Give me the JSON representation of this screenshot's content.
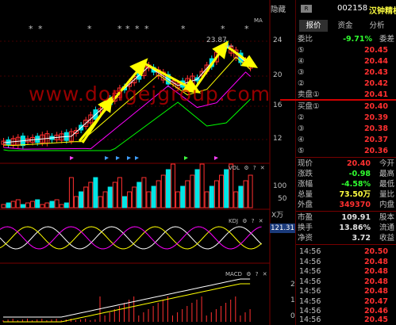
{
  "top_bar": {
    "hide_label": "隐藏",
    "r_badge": "R",
    "code": "002158",
    "name": "汉钟精机"
  },
  "tabs": [
    {
      "label": "报价"
    },
    {
      "label": "资金"
    },
    {
      "label": "分析"
    }
  ],
  "ratio": {
    "label": "委比",
    "value": "-9.71%",
    "label2": "委差"
  },
  "asks": [
    {
      "label": "⑤",
      "price": "20.45"
    },
    {
      "label": "④",
      "price": "20.44"
    },
    {
      "label": "③",
      "price": "20.43"
    },
    {
      "label": "②",
      "price": "20.42"
    },
    {
      "label": "卖盘①",
      "price": "20.41"
    }
  ],
  "bids": [
    {
      "label": "买盘①",
      "price": "20.40"
    },
    {
      "label": "②",
      "price": "20.39"
    },
    {
      "label": "③",
      "price": "20.38"
    },
    {
      "label": "④",
      "price": "20.37"
    },
    {
      "label": "⑤",
      "price": "20.36"
    }
  ],
  "stats": [
    {
      "label": "现价",
      "value": "20.40",
      "extra": "今开",
      "color": "red"
    },
    {
      "label": "涨跌",
      "value": "-0.98",
      "extra": "最高",
      "color": "green"
    },
    {
      "label": "涨幅",
      "value": "-4.58%",
      "extra": "最低",
      "color": "green"
    },
    {
      "label": "总量",
      "value": "73.50万",
      "extra": "量比",
      "color": "white"
    },
    {
      "label": "外盘",
      "value": "349370",
      "extra": "内盘",
      "color": "red"
    }
  ],
  "fundamentals": [
    {
      "label": "市盈",
      "value": "109.91",
      "extra": "股本"
    },
    {
      "label": "换手",
      "value": "13.86%",
      "extra": "流通"
    },
    {
      "label": "净资",
      "value": "3.72",
      "extra": "收益"
    }
  ],
  "ticks": [
    {
      "time": "14:56",
      "price": "20.50"
    },
    {
      "time": "14:56",
      "price": "20.48"
    },
    {
      "time": "14:56",
      "price": "20.48"
    },
    {
      "time": "14:56",
      "price": "20.48"
    },
    {
      "time": "14:56",
      "price": "20.48"
    },
    {
      "time": "14:56",
      "price": "20.47"
    },
    {
      "time": "14:56",
      "price": "20.46"
    },
    {
      "time": "14:56",
      "price": "20.45"
    }
  ],
  "price_axis": [
    "24",
    "20",
    "16",
    "12"
  ],
  "ma_label": "MA",
  "peak_label": "23.87",
  "watermark": "www.dongejgroup.com",
  "vol_panel": {
    "title": "VOL",
    "axis": [
      "100",
      "50"
    ],
    "unit": "X万"
  },
  "kdj_panel": {
    "title": "KDJ",
    "value": "121.31"
  },
  "macd_panel": {
    "title": "MACD",
    "axis": [
      "2",
      "1",
      "0"
    ]
  },
  "panel_icons": {
    "gear": "⚙",
    "help": "?",
    "close": "✕"
  },
  "colors": {
    "up": "#ff3030",
    "down": "#00e5e5",
    "ma5": "#ffffff",
    "ma10": "#ffff00",
    "ma20": "#ff00ff",
    "ma60": "#00ff00",
    "arrow": "#ffff00"
  }
}
